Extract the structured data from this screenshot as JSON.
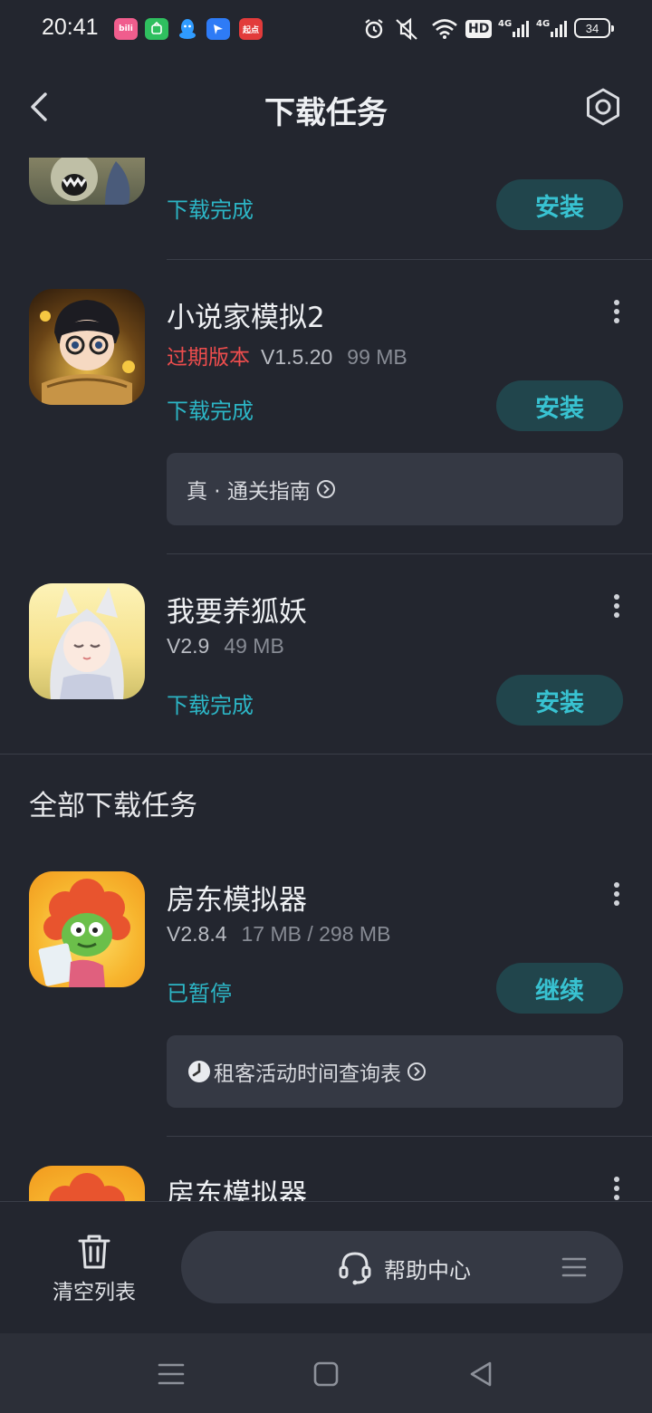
{
  "status_bar": {
    "time": "20:41",
    "app_icons": [
      {
        "name": "bilibili-icon",
        "label": "bili",
        "color": "#f05d8d"
      },
      {
        "name": "wechat-mini-icon",
        "label": "",
        "color": "#2fbf5f"
      },
      {
        "name": "qq-icon",
        "label": "",
        "color": "#2f9bff"
      },
      {
        "name": "feishu-icon",
        "label": "",
        "color": "#2e7bf6"
      },
      {
        "name": "qidian-icon",
        "label": "起点",
        "color": "#e23b3b"
      }
    ],
    "hd": "HD",
    "net1": "4G",
    "net2": "4G",
    "battery": "34"
  },
  "header": {
    "title": "下载任务"
  },
  "items": [
    {
      "status": "下载完成",
      "action": "安装"
    },
    {
      "name": "小说家模拟2",
      "expired": "过期版本",
      "version": "V1.5.20",
      "size": "99 MB",
      "status": "下载完成",
      "action": "安装",
      "guide": "真 · 通关指南"
    },
    {
      "name": "我要养狐妖",
      "version": "V2.9",
      "size": "49 MB",
      "status": "下载完成",
      "action": "安装"
    }
  ],
  "section_title": "全部下载任务",
  "all_items": [
    {
      "name": "房东模拟器",
      "version": "V2.8.4",
      "size": "17 MB / 298 MB",
      "status": "已暂停",
      "action": "继续",
      "guide": "租客活动时间查询表"
    },
    {
      "name": "房东模拟器"
    }
  ],
  "bottom": {
    "clear_label": "清空列表",
    "help_label": "帮助中心"
  },
  "colors": {
    "background": "#23262f",
    "accent": "#38c2d1",
    "status": "#2cb5c5",
    "expired": "#ee4d4d",
    "button_bg": "#21454c"
  }
}
